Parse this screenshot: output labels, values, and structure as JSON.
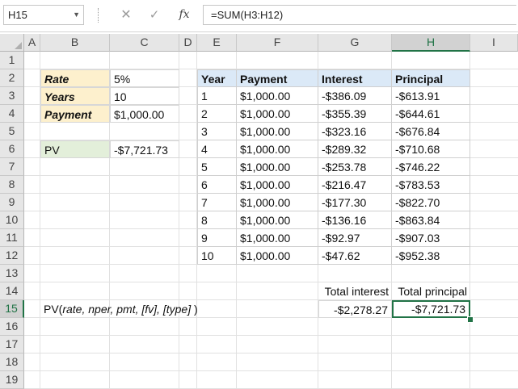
{
  "formula_bar": {
    "name_box": "H15",
    "cancel_icon": "✕",
    "enter_icon": "✓",
    "fx_label": "fx",
    "formula": "=SUM(H3:H12)"
  },
  "columns": [
    "A",
    "B",
    "C",
    "D",
    "E",
    "F",
    "G",
    "H",
    "I"
  ],
  "selected_column": "H",
  "rows": [
    "1",
    "2",
    "3",
    "4",
    "5",
    "6",
    "7",
    "8",
    "9",
    "10",
    "11",
    "12",
    "13",
    "14",
    "15",
    "16",
    "17",
    "18",
    "19"
  ],
  "selected_row": "15",
  "inputs": {
    "rate_label": "Rate",
    "rate_value": "5%",
    "years_label": "Years",
    "years_value": "10",
    "payment_label": "Payment",
    "payment_value": "$1,000.00",
    "pv_label": "PV",
    "pv_value": "-$7,721.73"
  },
  "table": {
    "headers": [
      "Year",
      "Payment",
      "Interest",
      "Principal"
    ],
    "rows": [
      [
        "1",
        "$1,000.00",
        "-$386.09",
        "-$613.91"
      ],
      [
        "2",
        "$1,000.00",
        "-$355.39",
        "-$644.61"
      ],
      [
        "3",
        "$1,000.00",
        "-$323.16",
        "-$676.84"
      ],
      [
        "4",
        "$1,000.00",
        "-$289.32",
        "-$710.68"
      ],
      [
        "5",
        "$1,000.00",
        "-$253.78",
        "-$746.22"
      ],
      [
        "6",
        "$1,000.00",
        "-$216.47",
        "-$783.53"
      ],
      [
        "7",
        "$1,000.00",
        "-$177.30",
        "-$822.70"
      ],
      [
        "8",
        "$1,000.00",
        "-$136.16",
        "-$863.84"
      ],
      [
        "9",
        "$1,000.00",
        "-$92.97",
        "-$907.03"
      ],
      [
        "10",
        "$1,000.00",
        "-$47.62",
        "-$952.38"
      ]
    ]
  },
  "totals": {
    "interest_label": "Total interest",
    "principal_label": "Total principal",
    "interest_value": "-$2,278.27",
    "principal_value": "-$7,721.73"
  },
  "syntax": {
    "fn": "PV(",
    "args": "rate, nper, pmt, [fv], [type]",
    "close": " )"
  },
  "colors": {
    "accent": "#217346",
    "input_fill": "#fdf0cd",
    "pv_fill": "#e3efda",
    "header_fill": "#dbe9f7"
  }
}
